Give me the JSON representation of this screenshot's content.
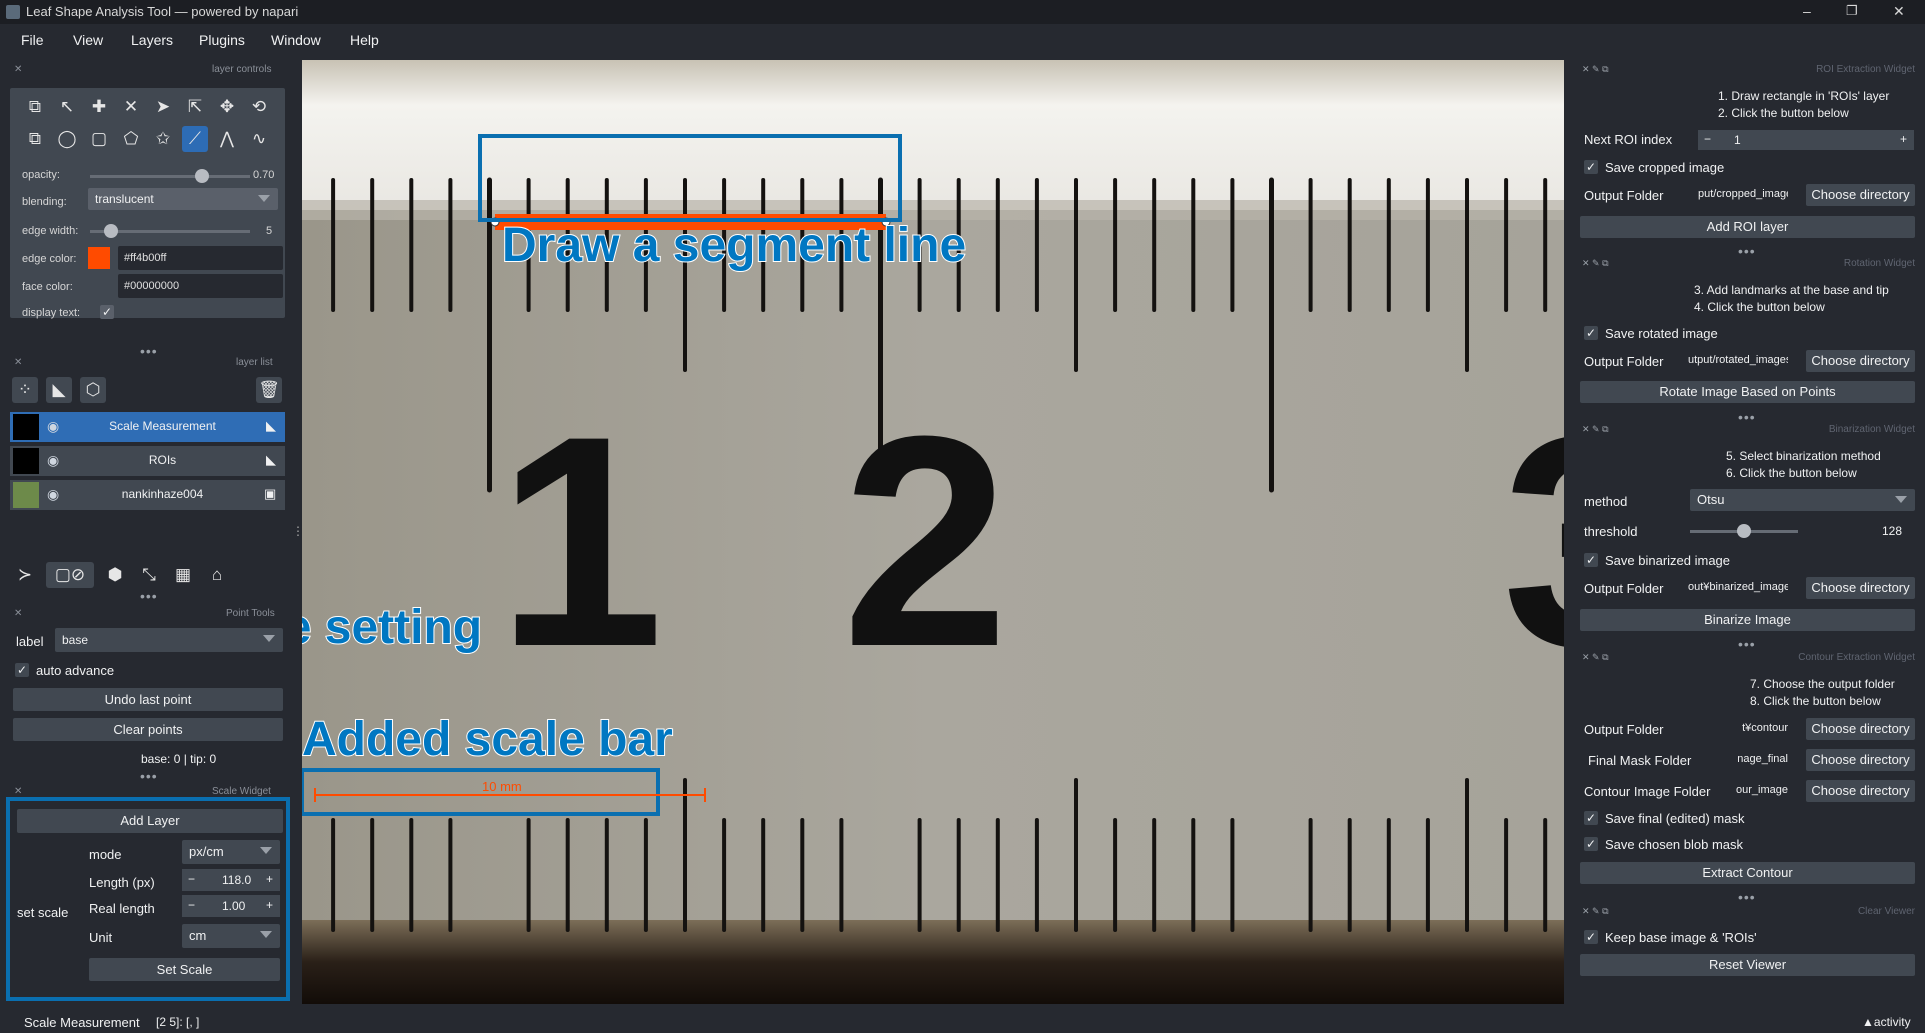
{
  "window": {
    "title": "Leaf Shape Analysis Tool — powered by napari",
    "controls": [
      "–",
      "❐",
      "✕"
    ]
  },
  "menu": [
    "File",
    "View",
    "Layers",
    "Plugins",
    "Window",
    "Help"
  ],
  "layer_controls": {
    "header": "layer controls",
    "opacity_label": "opacity:",
    "opacity_value": "0.70",
    "opacity_fraction": 0.7,
    "blending_label": "blending:",
    "blending_value": "translucent",
    "edge_width_label": "edge width:",
    "edge_width_value": "5",
    "edge_width_fraction": 0.13,
    "edge_color_label": "edge color:",
    "edge_color_value": "#ff4b00ff",
    "edge_color_swatch": "#ff4b00",
    "face_color_label": "face color:",
    "face_color_value": "#00000000",
    "display_text_label": "display text:"
  },
  "layer_list": {
    "header": "layer list",
    "layers": [
      {
        "name": "Scale Measurement",
        "selected": true,
        "type_icon": "shapes-icon"
      },
      {
        "name": "ROIs",
        "selected": false,
        "type_icon": "shapes-icon"
      },
      {
        "name": "nankinhaze004",
        "selected": false,
        "type_icon": "image-icon"
      }
    ]
  },
  "point_tools": {
    "header": "Point Tools",
    "label_label": "label",
    "label_value": "base",
    "auto_advance": "auto advance",
    "undo": "Undo last point",
    "clear": "Clear points",
    "status": "base: 0 | tip: 0"
  },
  "scale_widget": {
    "header": "Scale Widget",
    "add_layer": "Add Layer",
    "group_label": "set scale",
    "mode_label": "mode",
    "mode_value": "px/cm",
    "length_label": "Length (px)",
    "length_value": "118.0",
    "real_label": "Real length",
    "real_value": "1.00",
    "unit_label": "Unit",
    "unit_value": "cm",
    "set_scale": "Set Scale"
  },
  "annotations": {
    "segment": "Draw a segment line",
    "scale_setting": "Scale setting",
    "scale_bar": "Added scale bar",
    "scale_bar_text": "10 mm"
  },
  "ruler": {
    "major_labels": [
      "1",
      "2",
      "3"
    ]
  },
  "roi_widget": {
    "header": "ROI Extraction Widget",
    "instructions": [
      "1. Draw rectangle in 'ROIs' layer",
      "2. Click the button below"
    ],
    "next_label": "Next ROI index",
    "next_value": "1",
    "save_label": "Save cropped image",
    "output_label": "Output Folder",
    "output_value": "put/cropped_images",
    "choose": "Choose directory",
    "add_button": "Add ROI layer"
  },
  "rotation_widget": {
    "header": "Rotation Widget",
    "instructions": [
      "3. Add landmarks at the base and tip",
      "4. Click the button below"
    ],
    "save_label": "Save rotated image",
    "output_label": "Output Folder",
    "output_value": "utput/rotated_images",
    "choose": "Choose directory",
    "button": "Rotate Image Based on Points"
  },
  "binarization_widget": {
    "header": "Binarization Widget",
    "instructions": [
      "5. Select binarization method",
      "6. Click the button below"
    ],
    "method_label": "method",
    "method_value": "Otsu",
    "threshold_label": "threshold",
    "threshold_value": "128",
    "threshold_fraction": 0.5,
    "save_label": "Save binarized image",
    "output_label": "Output Folder",
    "output_value": "out¥binarized_images",
    "choose": "Choose directory",
    "button": "Binarize Image"
  },
  "contour_widget": {
    "header": "Contour Extraction Widget",
    "instructions": [
      "7. Choose the output folder",
      "8. Click the button below"
    ],
    "output_label": "Output Folder",
    "output_value": "t¥contour",
    "mask_label": "Final Mask Folder",
    "mask_value": "nage_final",
    "image_label": "Contour Image Folder",
    "image_value": "our_image",
    "choose": "Choose directory",
    "save_final": "Save final (edited) mask",
    "save_blob": "Save chosen blob mask",
    "button": "Extract Contour"
  },
  "clear_widget": {
    "header": "Clear Viewer",
    "keep_label": "Keep base image & 'ROIs'",
    "button": "Reset Viewer"
  },
  "status": {
    "layer": "Scale Measurement",
    "coords": "[2 5]: [, ]",
    "activity": "activity"
  }
}
